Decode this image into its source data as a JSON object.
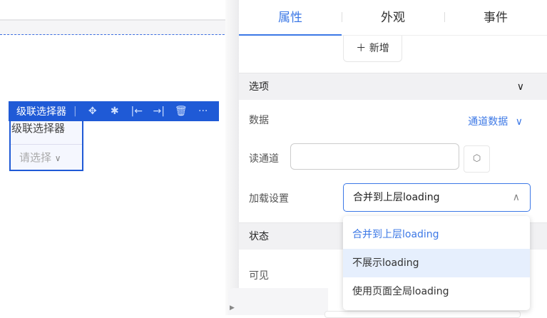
{
  "canvas": {
    "toolbar": {
      "title": "级联选择器",
      "icons": [
        "move-icon",
        "bug-icon",
        "align-left-icon",
        "align-right-icon",
        "trash-icon",
        "more-icon"
      ]
    },
    "component": {
      "label": "级联选择器",
      "placeholder": "请选择"
    }
  },
  "panel": {
    "tabs": [
      {
        "label": "属性",
        "active": true
      },
      {
        "label": "外观"
      },
      {
        "label": "事件"
      }
    ],
    "add_button": "＋ 新增",
    "section_options": "选项",
    "data_label": "数据",
    "data_value": "通道数据",
    "read_channel_label": "读通道",
    "read_channel_value": "",
    "loading_label": "加载设置",
    "loading_value": "合并到上层loading",
    "section_state": "状态",
    "visible_label": "可见",
    "dropdown": {
      "options": [
        {
          "label": "合并到上层loading",
          "selected": true
        },
        {
          "label": "不展示loading",
          "hovered": true
        },
        {
          "label": "使用页面全局loading"
        }
      ]
    }
  },
  "colors": {
    "accent": "#3c78e6",
    "toolbar": "#1f5ad6",
    "hover": "#e6effd"
  }
}
